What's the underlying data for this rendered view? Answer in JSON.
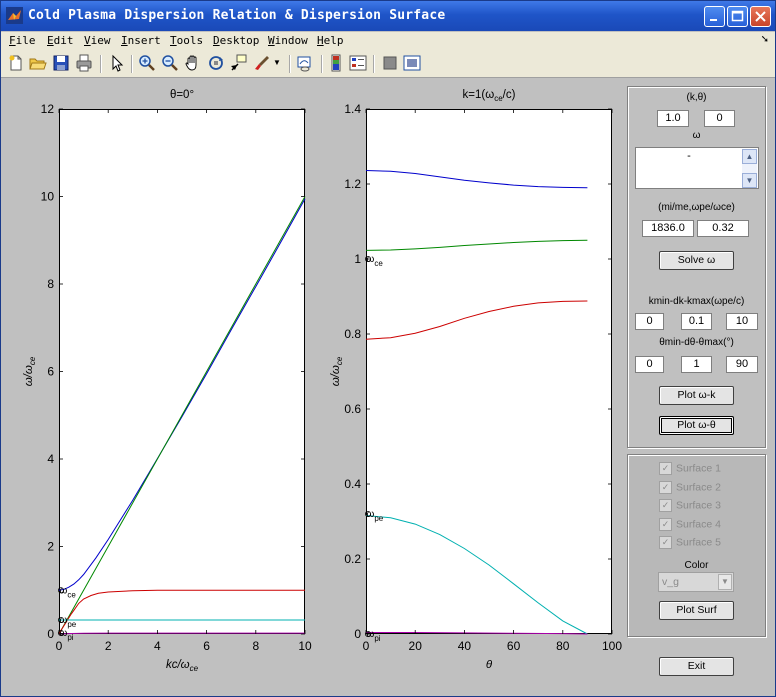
{
  "window": {
    "title": "Cold Plasma Dispersion Relation & Dispersion Surface"
  },
  "menu": [
    {
      "label": "File",
      "u": "F",
      "rest": "ile"
    },
    {
      "label": "Edit",
      "u": "E",
      "rest": "dit"
    },
    {
      "label": "View",
      "u": "V",
      "rest": "iew"
    },
    {
      "label": "Insert",
      "u": "I",
      "rest": "nsert"
    },
    {
      "label": "Tools",
      "u": "T",
      "rest": "ools"
    },
    {
      "label": "Desktop",
      "u": "D",
      "rest": "esktop"
    },
    {
      "label": "Window",
      "u": "W",
      "rest": "indow"
    },
    {
      "label": "Help",
      "u": "H",
      "rest": "elp"
    }
  ],
  "toolbar_icons": [
    "new-file-icon",
    "open-folder-icon",
    "save-icon",
    "print-icon",
    "pointer-icon",
    "zoom-in-icon",
    "zoom-out-icon",
    "pan-hand-icon",
    "rotate-3d-icon",
    "data-cursor-icon",
    "brush-icon",
    "link-plot-icon",
    "colorbar-icon",
    "legend-icon",
    "hide-plot-tools-icon",
    "show-plot-tools-icon"
  ],
  "chart_data": [
    {
      "type": "line",
      "title": "θ=0°",
      "xlabel": "kc/ω",
      "xlabel_sub": "ce",
      "ylabel": "ω/ω",
      "ylabel_sub": "ce",
      "xlim": [
        0,
        10
      ],
      "ylim": [
        0,
        12
      ],
      "xticks": [
        "0",
        "2",
        "4",
        "6",
        "8",
        "10"
      ],
      "yticks": [
        "0",
        "2",
        "4",
        "6",
        "8",
        "10",
        "12"
      ],
      "series": [
        {
          "color": "#0000cc",
          "x": [
            0,
            0.2,
            0.4,
            0.6,
            0.8,
            1.0,
            1.5,
            2,
            3,
            4,
            5,
            6,
            7,
            8,
            9,
            10
          ],
          "y": [
            1.0,
            1.02,
            1.07,
            1.14,
            1.24,
            1.36,
            1.74,
            2.16,
            3.06,
            4.01,
            4.97,
            5.95,
            6.95,
            7.94,
            8.94,
            9.95
          ]
        },
        {
          "color": "#008800",
          "x": [
            0,
            0.5,
            1.0,
            2,
            3,
            4,
            5,
            6,
            7,
            8,
            9,
            10
          ],
          "y": [
            0,
            0.5,
            1.0,
            2,
            3,
            4,
            5,
            6,
            7,
            8,
            9,
            10
          ]
        },
        {
          "color": "#cc0000",
          "x": [
            0,
            0.1,
            0.2,
            0.3,
            0.4,
            0.5,
            0.6,
            0.8,
            1.0,
            1.3,
            1.6,
            2,
            3,
            4,
            6,
            8,
            10
          ],
          "y": [
            0,
            0.1,
            0.19,
            0.28,
            0.37,
            0.46,
            0.54,
            0.7,
            0.8,
            0.88,
            0.93,
            0.96,
            0.99,
            1.0,
            1.0,
            1.0,
            1.0
          ]
        },
        {
          "color": "#00b0b0",
          "x": [
            0,
            0.2,
            0.4,
            0.6,
            1,
            2,
            4,
            6,
            8,
            10
          ],
          "y": [
            0.32,
            0.32,
            0.32,
            0.32,
            0.32,
            0.32,
            0.32,
            0.32,
            0.32,
            0.32
          ]
        },
        {
          "color": "#aa00aa",
          "x": [
            0,
            0.5,
            1,
            2,
            4,
            6,
            8,
            10
          ],
          "y": [
            0.0,
            0.012,
            0.018,
            0.02,
            0.021,
            0.021,
            0.021,
            0.021
          ]
        }
      ],
      "markers": [
        {
          "x": 0,
          "y": 1.0,
          "label": "ω",
          "sub": "ce"
        },
        {
          "x": 0,
          "y": 0.32,
          "label": "ω",
          "sub": "pe"
        },
        {
          "x": 0,
          "y": 0.023,
          "label": "ω",
          "sub": "pi"
        }
      ]
    },
    {
      "type": "line",
      "title": "k=1(ω",
      "title_sub": "ce",
      "title_end": "/c)",
      "xlabel": "θ",
      "ylabel": "ω/ω",
      "ylabel_sub": "ce",
      "xlim": [
        0,
        100
      ],
      "ylim": [
        0,
        1.4
      ],
      "xticks": [
        "0",
        "20",
        "40",
        "60",
        "80",
        "100"
      ],
      "yticks": [
        "0",
        "0.2",
        "0.4",
        "0.6",
        "0.8",
        "1",
        "1.2",
        "1.4"
      ],
      "series": [
        {
          "color": "#0000cc",
          "x": [
            0,
            10,
            20,
            30,
            40,
            50,
            60,
            70,
            80,
            90
          ],
          "y": [
            1.236,
            1.234,
            1.228,
            1.219,
            1.21,
            1.203,
            1.197,
            1.193,
            1.191,
            1.19
          ]
        },
        {
          "color": "#008800",
          "x": [
            0,
            10,
            20,
            30,
            40,
            50,
            60,
            70,
            80,
            90
          ],
          "y": [
            1.023,
            1.024,
            1.027,
            1.031,
            1.036,
            1.04,
            1.044,
            1.047,
            1.049,
            1.05
          ]
        },
        {
          "color": "#cc0000",
          "x": [
            0,
            10,
            20,
            30,
            40,
            50,
            60,
            70,
            80,
            90
          ],
          "y": [
            0.786,
            0.79,
            0.802,
            0.82,
            0.842,
            0.86,
            0.874,
            0.883,
            0.887,
            0.888
          ]
        },
        {
          "color": "#00b0b0",
          "x": [
            0,
            10,
            20,
            30,
            40,
            50,
            60,
            70,
            80,
            90
          ],
          "y": [
            0.316,
            0.31,
            0.293,
            0.265,
            0.228,
            0.184,
            0.134,
            0.083,
            0.035,
            0.0
          ]
        },
        {
          "color": "#aa00aa",
          "x": [
            0,
            20,
            40,
            60,
            80,
            90
          ],
          "y": [
            0.004,
            0.004,
            0.003,
            0.002,
            0.001,
            0.0
          ]
        }
      ],
      "markers": [
        {
          "x": 0,
          "y": 1.0,
          "label": "ω",
          "sub": "ce"
        },
        {
          "x": 0,
          "y": 0.32,
          "label": "ω",
          "sub": "pe"
        },
        {
          "x": 0,
          "y": 0.0,
          "label": "ω",
          "sub": "pi"
        }
      ]
    }
  ],
  "controls": {
    "k_theta_label": "(k,θ)",
    "k_value": "1.0",
    "theta_value": "0",
    "omega_label": "ω",
    "omega_list_text": "-",
    "ratio_label": "(mi/me,ωpe/ωce)",
    "mi_me_value": "1836.0",
    "wpe_wce_value": "0.32",
    "solve_button": "Solve ω",
    "k_range_label": "kmin-dk-kmax(ωpe/c)",
    "kmin": "0",
    "dk": "0.1",
    "kmax": "10",
    "theta_range_label": "θmin-dθ-θmax(°)",
    "theta_min": "0",
    "dtheta": "1",
    "theta_max": "90",
    "plot_wk_button": "Plot ω-k",
    "plot_wtheta_button": "Plot ω-θ",
    "surfaces": [
      "Surface 1",
      "Surface 2",
      "Surface 3",
      "Surface 4",
      "Surface 5"
    ],
    "color_label": "Color",
    "color_value": "v_g",
    "plot_surf_button": "Plot Surf",
    "exit_button": "Exit"
  }
}
